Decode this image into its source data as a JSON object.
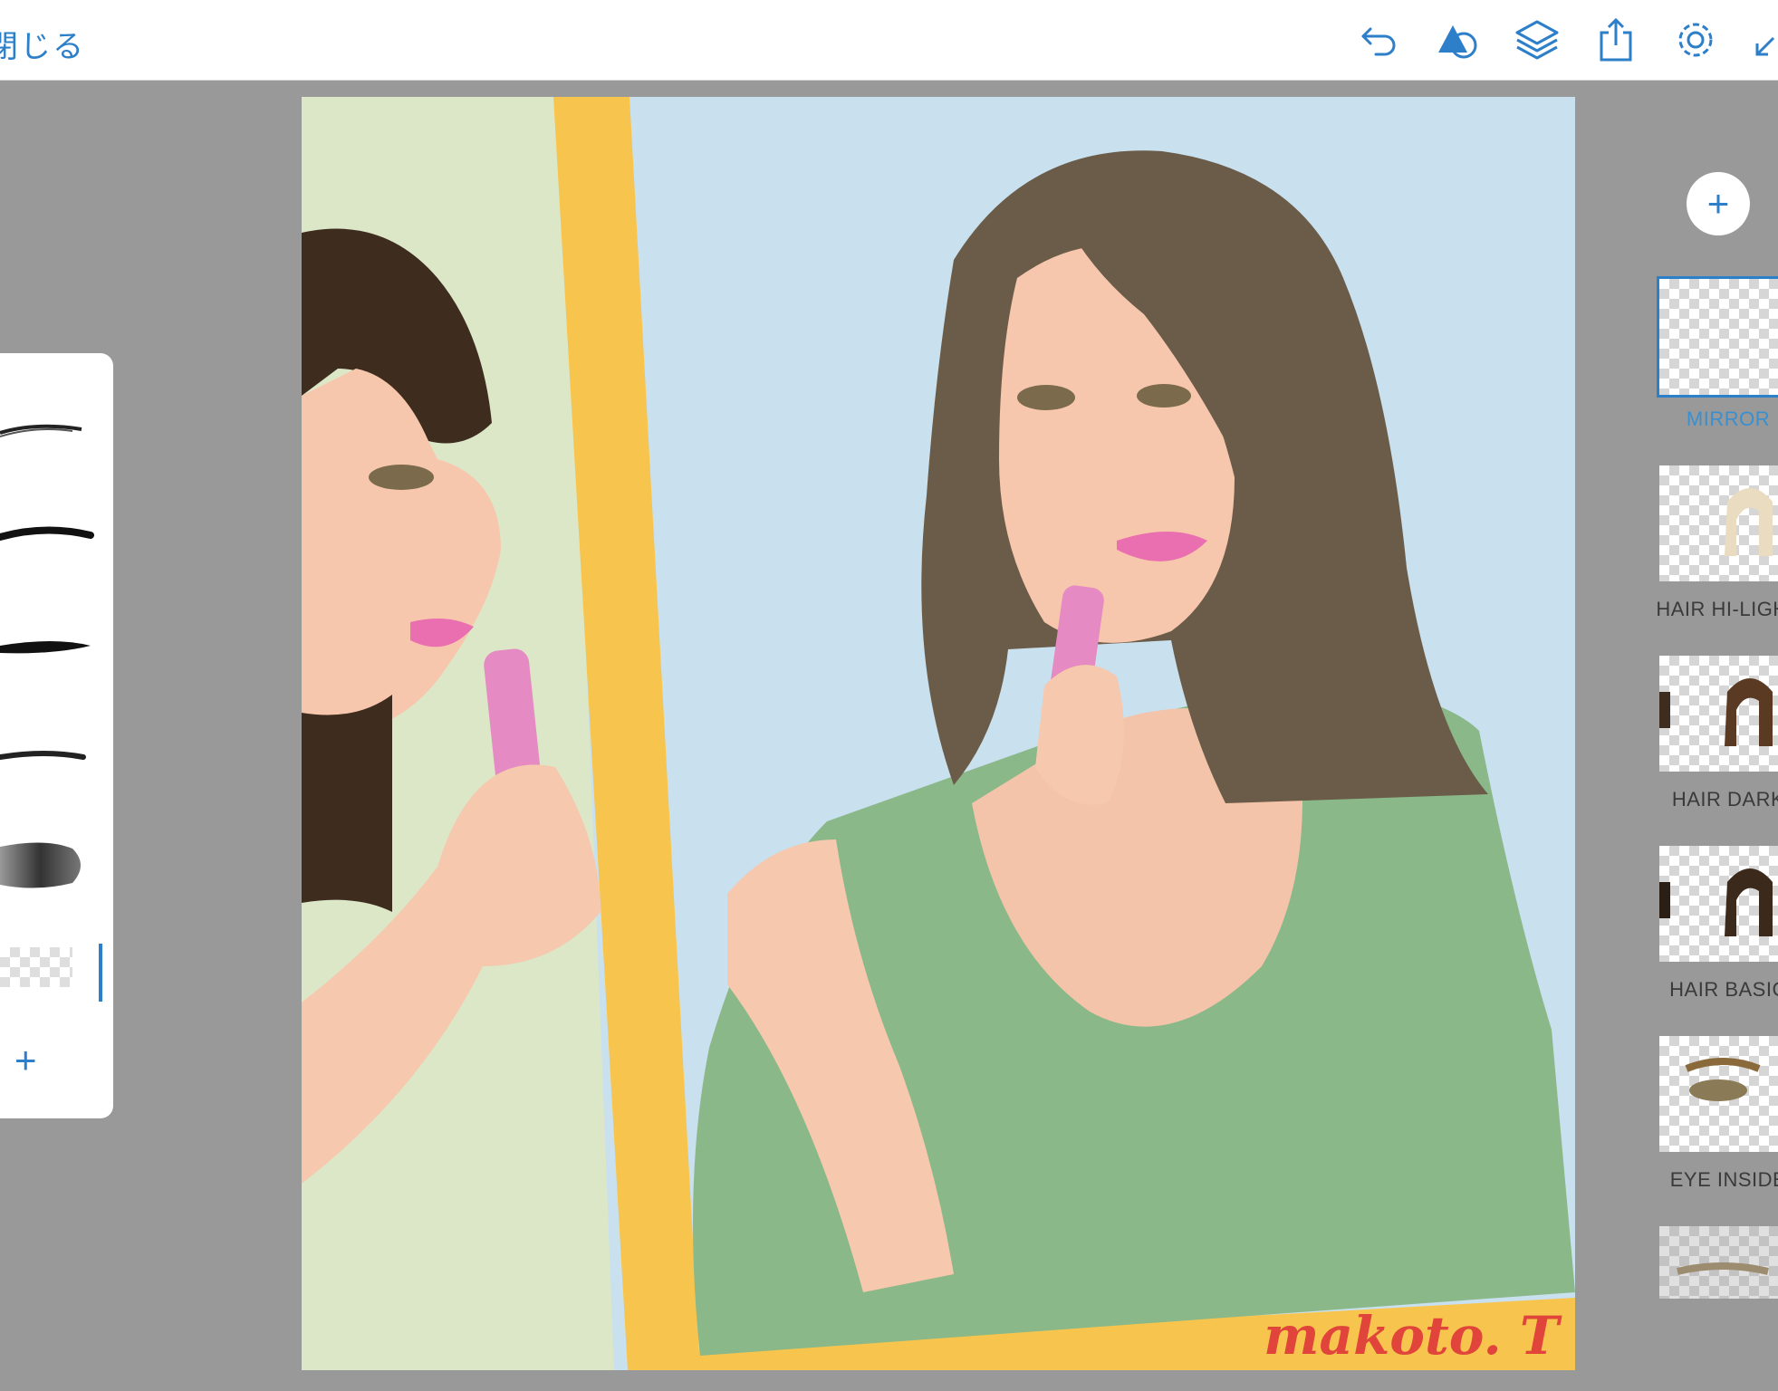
{
  "topbar": {
    "close_label": "閉じる",
    "icons": [
      "undo-icon",
      "shape-icon",
      "layers-icon",
      "share-icon",
      "settings-icon",
      "collapse-icon"
    ]
  },
  "canvas": {
    "signature": "makoto. T"
  },
  "brush_panel": {
    "add_label": "+"
  },
  "layers": {
    "add_label": "+",
    "items": [
      {
        "label": "MIRROR",
        "selected": true
      },
      {
        "label": "HAIR HI-LIGHT",
        "selected": false
      },
      {
        "label": "HAIR DARK",
        "selected": false
      },
      {
        "label": "HAIR BASIC",
        "selected": false
      },
      {
        "label": "EYE INSIDE",
        "selected": false
      }
    ]
  },
  "colors": {
    "accent": "#2d7fc9",
    "background": "#999999",
    "mirror_frame": "#f7c54e",
    "shirt": "#8ab889",
    "skin": "#f7c7ad",
    "hair": "#6b5c4a",
    "lipstick": "#e88ac0"
  }
}
